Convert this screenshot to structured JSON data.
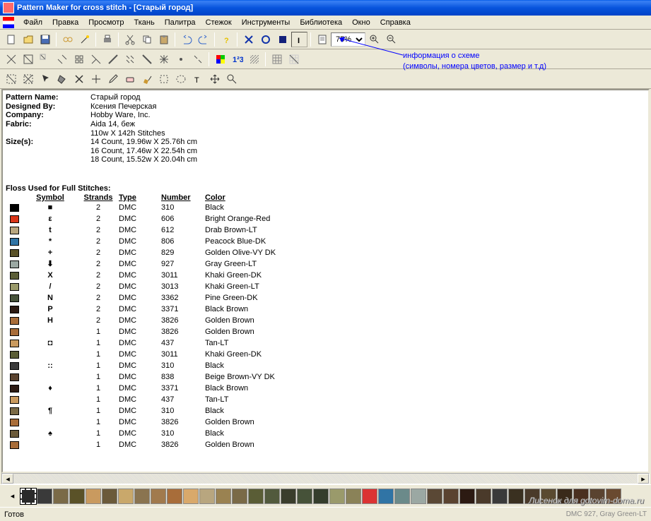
{
  "title": "Pattern Maker for cross stitch - [Старый город]",
  "menu": [
    "Файл",
    "Правка",
    "Просмотр",
    "Ткань",
    "Палитра",
    "Стежок",
    "Инструменты",
    "Библиотека",
    "Окно",
    "Справка"
  ],
  "zoom": "75%",
  "annotation": {
    "l1": "информация о схеме",
    "l2": "(символы, номера цветов, размер и т.д)"
  },
  "info": {
    "pattern_name_lbl": "Pattern Name:",
    "pattern_name": "Старый город",
    "designed_by_lbl": "Designed By:",
    "designed_by": "Ксения Печерская",
    "company_lbl": "Company:",
    "company": "Hobby Ware, Inc.",
    "fabric_lbl": "Fabric:",
    "fabric": "Aida 14, беж",
    "stitches": "110w X 142h Stitches",
    "sizes_lbl": "Size(s):",
    "s14": "14 Count,   19.96w X 25.76h cm",
    "s16": "16 Count,   17.46w X 22.54h cm",
    "s18": "18 Count,   15.52w X 20.04h cm"
  },
  "floss_title": "Floss Used for Full Stitches:",
  "floss_hdr": {
    "symbol": "Symbol",
    "strands": "Strands",
    "type": "Type",
    "number": "Number",
    "color": "Color"
  },
  "floss": [
    {
      "c": "#000000",
      "sym": "■",
      "str": "2",
      "type": "DMC",
      "num": "310",
      "color": "Black"
    },
    {
      "c": "#d93518",
      "sym": "ε",
      "str": "2",
      "type": "DMC",
      "num": "606",
      "color": "Bright Orange-Red"
    },
    {
      "c": "#b8a67f",
      "sym": "t",
      "str": "2",
      "type": "DMC",
      "num": "612",
      "color": "Drab Brown-LT"
    },
    {
      "c": "#3074a5",
      "sym": "*",
      "str": "2",
      "type": "DMC",
      "num": "806",
      "color": "Peacock Blue-DK"
    },
    {
      "c": "#5a5228",
      "sym": "+",
      "str": "2",
      "type": "DMC",
      "num": "829",
      "color": "Golden Olive-VY DK"
    },
    {
      "c": "#9ba8a3",
      "sym": "⬇",
      "str": "2",
      "type": "DMC",
      "num": "927",
      "color": "Gray Green-LT"
    },
    {
      "c": "#5a5d36",
      "sym": "Х",
      "str": "2",
      "type": "DMC",
      "num": "3011",
      "color": "Khaki Green-DK"
    },
    {
      "c": "#9a9a6b",
      "sym": "/",
      "str": "2",
      "type": "DMC",
      "num": "3013",
      "color": "Khaki Green-LT"
    },
    {
      "c": "#465239",
      "sym": "N",
      "str": "2",
      "type": "DMC",
      "num": "3362",
      "color": "Pine Green-DK"
    },
    {
      "c": "#2c1a12",
      "sym": "P",
      "str": "2",
      "type": "DMC",
      "num": "3371",
      "color": "Black Brown"
    },
    {
      "c": "#a86d3a",
      "sym": "Н",
      "str": "2",
      "type": "DMC",
      "num": "3826",
      "color": "Golden Brown"
    },
    {
      "c": "#a86d3a",
      "sym": "",
      "str": "1",
      "type": "DMC",
      "num": "3826",
      "color": "Golden Brown"
    },
    {
      "c": "#c99a5f",
      "sym": "◘",
      "str": "1",
      "type": "DMC",
      "num": "437",
      "color": "Tan-LT"
    },
    {
      "c": "#5a5d36",
      "sym": "",
      "str": "1",
      "type": "DMC",
      "num": "3011",
      "color": "Khaki Green-DK"
    },
    {
      "c": "#3a3a3a",
      "sym": "::",
      "str": "1",
      "type": "DMC",
      "num": "310",
      "color": "Black"
    },
    {
      "c": "#5a4330",
      "sym": "",
      "str": "1",
      "type": "DMC",
      "num": "838",
      "color": "Beige Brown-VY DK"
    },
    {
      "c": "#2c1a12",
      "sym": "♦",
      "str": "1",
      "type": "DMC",
      "num": "3371",
      "color": "Black Brown"
    },
    {
      "c": "#c99a5f",
      "sym": "",
      "str": "1",
      "type": "DMC",
      "num": "437",
      "color": "Tan-LT"
    },
    {
      "c": "#7a6a47",
      "sym": "¶",
      "str": "1",
      "type": "DMC",
      "num": "310",
      "color": "Black"
    },
    {
      "c": "#a86d3a",
      "sym": "",
      "str": "1",
      "type": "DMC",
      "num": "3826",
      "color": "Golden Brown"
    },
    {
      "c": "#6b5a3a",
      "sym": "♠",
      "str": "1",
      "type": "DMC",
      "num": "310",
      "color": "Black"
    },
    {
      "c": "#a86d3a",
      "sym": "",
      "str": "1",
      "type": "DMC",
      "num": "3826",
      "color": "Golden Brown"
    }
  ],
  "palette": [
    "#2a2a2a",
    "#3a3a3a",
    "#7a6a47",
    "#5a5228",
    "#c99a5f",
    "#6b5a3a",
    "#c9a86b",
    "#8a7450",
    "#a17a4d",
    "#a86d3a",
    "#d9a96b",
    "#b8a67f",
    "#9a8251",
    "#7a6a47",
    "#5a5d36",
    "#525a3d",
    "#3a3d2c",
    "#465239",
    "#343d2c",
    "#9a9a6b",
    "#8a8258",
    "#db3333",
    "#3074a5",
    "#6b8a8a",
    "#9ba8a3",
    "#5a4835",
    "#5a4330",
    "#2c1a12",
    "#4a3a2a",
    "#3a3a3a",
    "#3a3020",
    "#4a3a2a",
    "#5a4a30",
    "#3a2a1a",
    "#4a3020",
    "#5a4330",
    "#6a4a30"
  ],
  "status": {
    "left": "Готов",
    "right": "DMC  927, Gray Green-LT"
  },
  "watermark": "Лисенок для gotovim-doma.ru"
}
